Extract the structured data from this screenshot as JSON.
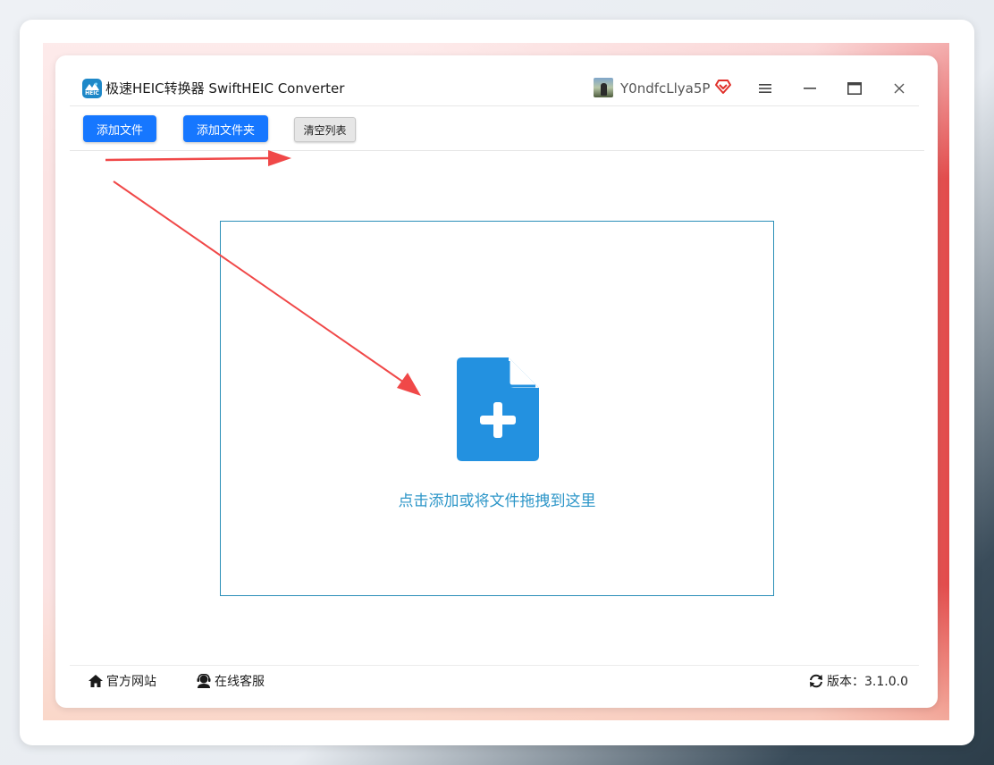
{
  "app": {
    "title": "极速HEIC转换器 SwiftHEIC Converter",
    "logo_text": "HEIC",
    "username": "Y0ndfcLlya5P"
  },
  "toolbar": {
    "add_file_label": "添加文件",
    "add_folder_label": "添加文件夹",
    "clear_list_label": "清空列表"
  },
  "drop_zone": {
    "hint": "点击添加或将文件拖拽到这里"
  },
  "footer": {
    "website_label": "官方网站",
    "service_label": "在线客服",
    "version_label": "版本：3.1.0.0"
  },
  "colors": {
    "primary": "#1677ff",
    "drop_border": "#2b8fb8",
    "drop_text": "#2d96c8",
    "icon_blue": "#2391e0",
    "arrow_red": "#f04848",
    "vip_red": "#e0302a"
  },
  "icons": {
    "logo": "heic-logo-icon",
    "vip": "vip-diamond-icon",
    "menu": "hamburger-menu-icon",
    "minimize": "minimize-icon",
    "maximize": "maximize-icon",
    "close": "close-icon",
    "file_add": "file-add-icon",
    "home": "home-icon",
    "service": "customer-service-icon",
    "refresh": "refresh-icon"
  }
}
